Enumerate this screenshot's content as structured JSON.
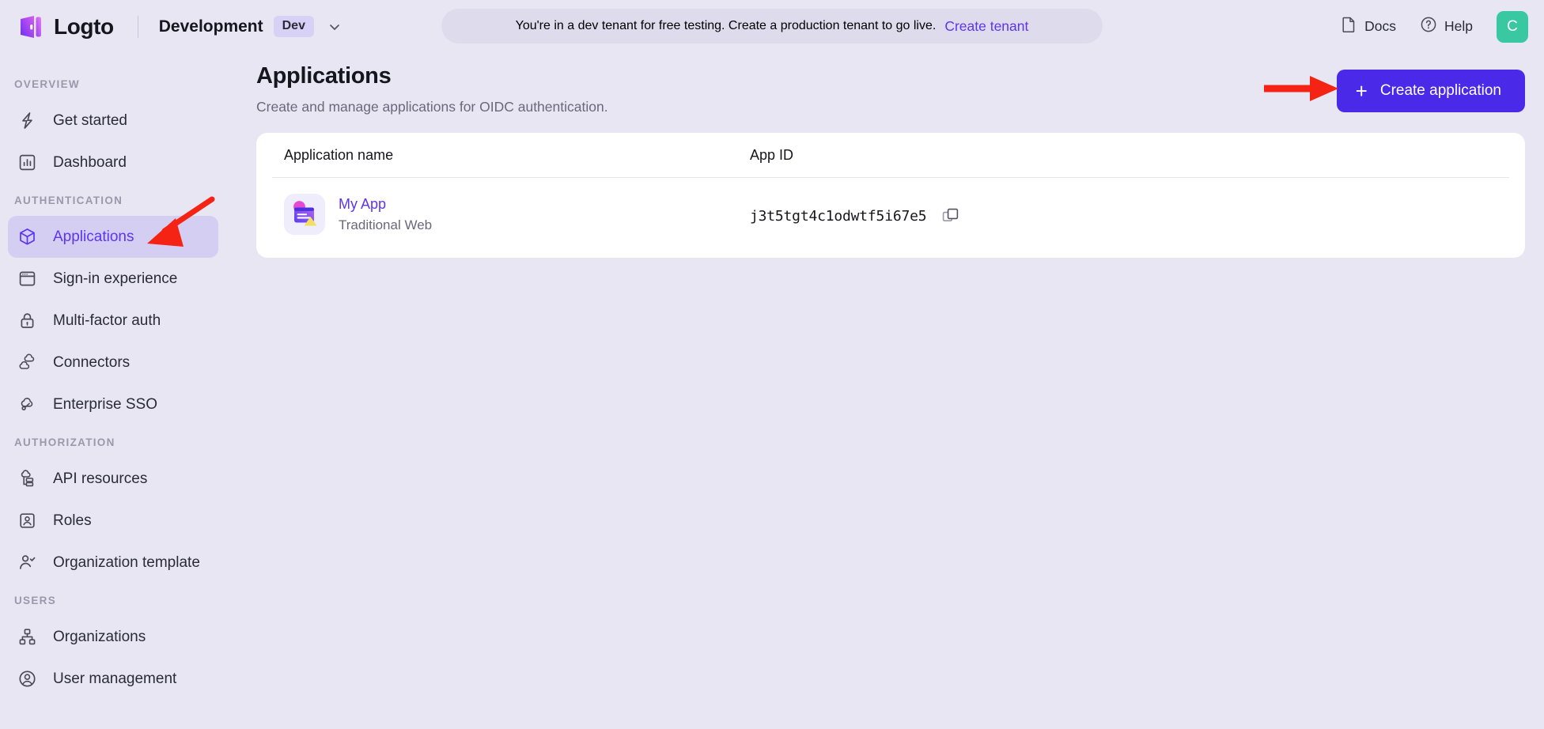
{
  "colors": {
    "app_background": "#e8e6f3",
    "accent_purple": "#5d34f2",
    "button_purple": "#4b29e8",
    "nav_active_bg": "#d4cff2",
    "avatar_green": "#3ac8a3",
    "annotation_red": "#f42314",
    "card_white": "#ffffff"
  },
  "topbar": {
    "logo_icon": "logto-logo-icon",
    "brand_name": "Logto",
    "tenant_name": "Development",
    "tenant_badge": "Dev",
    "tenant_caret_icon": "chevron-down-icon",
    "banner": {
      "text": "You're in a dev tenant for free testing. Create a production tenant to go live.",
      "link_label": "Create tenant"
    },
    "actions": [
      {
        "label": "Docs",
        "icon": "document-icon"
      },
      {
        "label": "Help",
        "icon": "question-circle-icon"
      }
    ],
    "avatar_initial": "C"
  },
  "sidebar": {
    "sections": [
      {
        "title": "OVERVIEW",
        "items": [
          {
            "label": "Get started",
            "icon": "lightning-bolt-icon",
            "active": false
          },
          {
            "label": "Dashboard",
            "icon": "bar-chart-icon",
            "active": false
          }
        ]
      },
      {
        "title": "AUTHENTICATION",
        "items": [
          {
            "label": "Applications",
            "icon": "cube-icon",
            "active": true
          },
          {
            "label": "Sign-in experience",
            "icon": "browser-window-icon",
            "active": false
          },
          {
            "label": "Multi-factor auth",
            "icon": "lock-icon",
            "active": false
          },
          {
            "label": "Connectors",
            "icon": "connectors-cloud-icon",
            "active": false
          },
          {
            "label": "Enterprise SSO",
            "icon": "cloud-key-icon",
            "active": false
          }
        ]
      },
      {
        "title": "AUTHORIZATION",
        "items": [
          {
            "label": "API resources",
            "icon": "api-resource-icon",
            "active": false
          },
          {
            "label": "Roles",
            "icon": "person-badge-icon",
            "active": false
          },
          {
            "label": "Organization template",
            "icon": "person-check-icon",
            "active": false
          }
        ]
      },
      {
        "title": "USERS",
        "items": [
          {
            "label": "Organizations",
            "icon": "org-tree-icon",
            "active": false
          },
          {
            "label": "User management",
            "icon": "user-circle-icon",
            "active": false
          }
        ]
      }
    ]
  },
  "main": {
    "title": "Applications",
    "subtitle": "Create and manage applications for OIDC authentication.",
    "create_button": {
      "label": "Create application",
      "plus_glyph": "+"
    },
    "table": {
      "columns": [
        "Application name",
        "App ID"
      ],
      "rows": [
        {
          "app_icon": "traditional-web-app-icon",
          "name": "My App",
          "type": "Traditional Web",
          "app_id": "j3t5tgt4c1odwtf5i67e5",
          "copy_icon": "copy-icon"
        }
      ]
    }
  },
  "annotations": [
    {
      "name": "arrow-to-applications-nav",
      "shape": "arrow",
      "direction": "down-left"
    },
    {
      "name": "arrow-to-create-application-button",
      "shape": "arrow",
      "direction": "right"
    }
  ]
}
